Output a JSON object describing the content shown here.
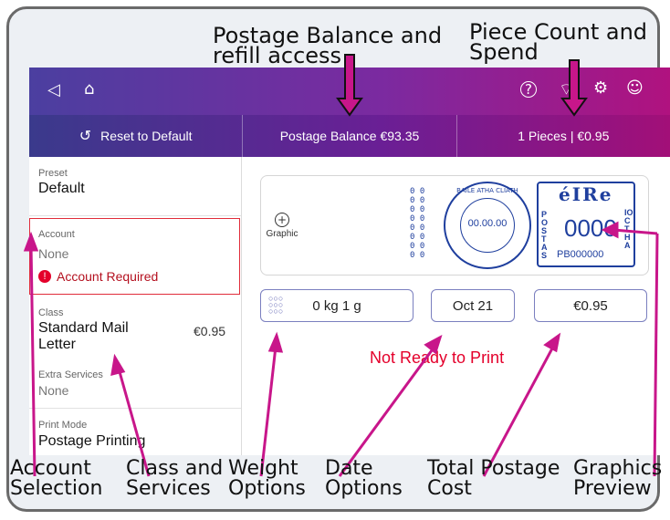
{
  "callouts": {
    "postage_balance": "Postage Balance and refill access",
    "piece_count": "Piece Count and Spend",
    "account_selection": "Account Selection",
    "class_services": "Class and Services",
    "weight_options": "Weight Options",
    "date_options": "Date Options",
    "total_cost": "Total Postage Cost",
    "graphics_preview": "Graphics Preview"
  },
  "tabs": {
    "reset": "Reset to Default",
    "balance": "Postage Balance €93.35",
    "pieces": "1 Pieces | €0.95"
  },
  "sidebar": {
    "preset_label": "Preset",
    "preset_value": "Default",
    "account_label": "Account",
    "account_value": "None",
    "account_warning": "Account Required",
    "class_label": "Class",
    "class_value_1": "Standard Mail",
    "class_value_2": "Letter",
    "class_price": "€0.95",
    "extra_label": "Extra Services",
    "extra_value": "None",
    "print_mode_label": "Print Mode",
    "print_mode_value": "Postage Printing"
  },
  "main": {
    "graphic_label": "Graphic",
    "weight": "0 kg 1 g",
    "date": "Oct 21",
    "total": "€0.95",
    "status": "Not Ready to Print",
    "postmark_date": "00.00.00",
    "postmark_top": "BAILE ATHA CLIATH",
    "eire": "éIRe",
    "stamp_value": "0000",
    "stamp_id": "PB000000",
    "postas": "POSTAS",
    "iocht": "IOCTHA",
    "zeros": [
      "0 0",
      "0 0",
      "0 0",
      "0 0",
      "0 0",
      "0 0",
      "0 0",
      "0 0"
    ]
  },
  "colors": {
    "callout_arrow": "#c8168a",
    "status_red": "#e4002b",
    "warning_red": "#e4002b",
    "stamp_blue": "#1f3f9e"
  }
}
